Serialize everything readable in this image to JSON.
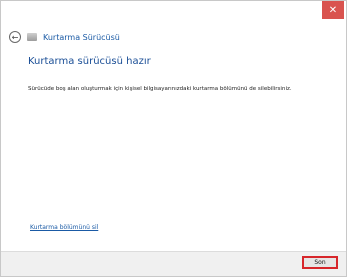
{
  "window": {
    "title": "Kurtarma Sürücüsü",
    "close_icon": "close-icon"
  },
  "content": {
    "heading": "Kurtarma sürücüsü hazır",
    "description": "Sürücüde boş alan oluşturmak için kişisel bilgisayarınızdaki kurtarma bölümünü de silebilirsiniz.",
    "delete_link": "Kurtarma bölümünü sil"
  },
  "footer": {
    "finish_label": "Son"
  },
  "colors": {
    "accent": "#1a5aa5",
    "close_bg": "#d9534f",
    "highlight": "#d7262b"
  }
}
